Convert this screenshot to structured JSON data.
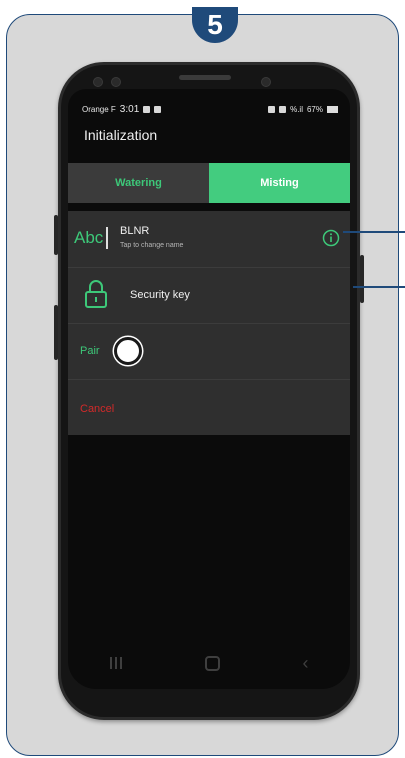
{
  "step": {
    "number": "5"
  },
  "status_bar": {
    "carrier": "Orange F",
    "time": "3:01",
    "signal": "%.il",
    "battery": "67%"
  },
  "app": {
    "title": "Initialization"
  },
  "tabs": [
    {
      "label": "Watering",
      "active": false
    },
    {
      "label": "Misting",
      "active": true
    }
  ],
  "device": {
    "icon_text": "Abc",
    "name": "BLNR",
    "subtitle": "Tap to change name",
    "info_icon": "info-icon"
  },
  "security": {
    "label": "Security key",
    "icon": "lock-icon"
  },
  "pair": {
    "label": "Pair"
  },
  "cancel": {
    "label": "Cancel"
  },
  "colors": {
    "accent_green": "#43cc7f",
    "cancel_red": "#d22a2a",
    "frame_blue": "#1f4a7a"
  }
}
